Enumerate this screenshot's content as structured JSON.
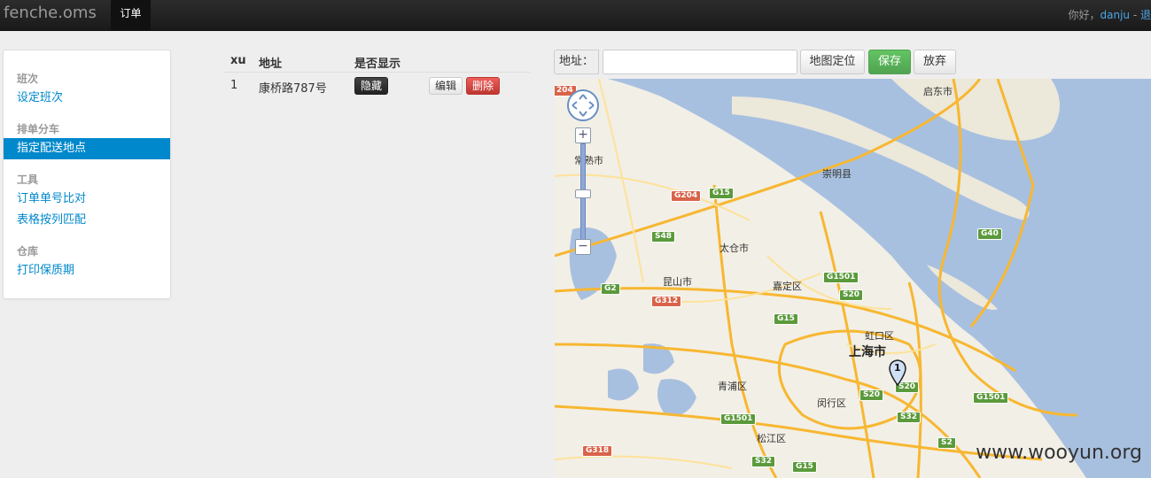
{
  "topbar": {
    "brand": "fenche.oms",
    "tab_orders": "订单",
    "greeting": "你好，",
    "username": "danju",
    "separator": " - ",
    "logout": "退"
  },
  "sidebar": {
    "sections": [
      {
        "header": "班次",
        "items": [
          "设定班次"
        ]
      },
      {
        "header": "排单分车",
        "items": [
          "指定配送地点"
        ]
      },
      {
        "header": "工具",
        "items": [
          "订单单号比对",
          "表格按列匹配"
        ]
      },
      {
        "header": "仓库",
        "items": [
          "打印保质期"
        ]
      }
    ],
    "active_item": "指定配送地点"
  },
  "table": {
    "headers": [
      "xu",
      "地址",
      "是否显示"
    ],
    "rows": [
      {
        "xu": "1",
        "address": "康桥路787号",
        "hide_label": "隐藏",
        "edit_label": "编辑",
        "delete_label": "删除"
      }
    ]
  },
  "addressbar": {
    "label": "地址：",
    "input_value": "",
    "input_placeholder": "",
    "locate_label": "地图定位",
    "save_label": "保存",
    "discard_label": "放弃"
  },
  "map": {
    "place_labels": [
      "启东市",
      "常熟市",
      "崇明县",
      "太仓市",
      "昆山市",
      "嘉定区",
      "虹口区",
      "上海市",
      "青浦区",
      "闵行区",
      "松江区"
    ],
    "road_shields": [
      "G204",
      "G15",
      "S48",
      "G40",
      "G2",
      "G312",
      "G1501",
      "S20",
      "G15",
      "S20",
      "S20",
      "G1501",
      "G1501",
      "S32",
      "S2",
      "G318",
      "S32",
      "G15",
      "204"
    ],
    "marker_label": "1",
    "zoom_in": "+",
    "zoom_out": "−",
    "watermark": "www.wooyun.org",
    "colors": {
      "water": "#a8c0e0",
      "land": "#f2efe6",
      "highway": "#f7b731",
      "shield_green": "#5b9a3c",
      "shield_red": "#d9634a"
    }
  }
}
